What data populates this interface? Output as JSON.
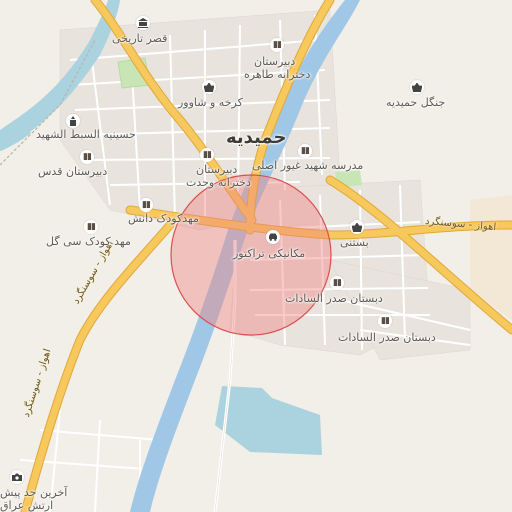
{
  "map": {
    "city_label": "حمیدیه",
    "road_labels": {
      "east_highway": "اهواز - سوسنگرد",
      "south_west_highway": "اهواز - سوسنگرد",
      "south_west_highway_2": "اهواز - سوسنگرد"
    },
    "places": {
      "historic_palace": "قصر تاریخی",
      "girls_high_school_tahereh_line1": "دبیرستان",
      "girls_high_school_tahereh_line2": "دخترانه طاهره",
      "karkheh_shavour": "کرخه و شاوور",
      "hamidiyeh_forest": "جنگل حمیدیه",
      "hosseiniyeh": "حسینیه السبط الشهید",
      "school_ghayour": "مدرسه شهید غیور اصلی",
      "high_school_qods": "دبیرستان قدس",
      "girls_high_school_vahdat_line1": "دبیرستان",
      "girls_high_school_vahdat_line2": "دخترانه وحدت",
      "kindergarten_danesh": "مهدکودک دانش",
      "kindergarten_sibgol": "مهد کودک سی گل",
      "tractor_mechanic": "مکانیکی تراکتور",
      "bastani": "بستنی",
      "primary_sadr_1": "دبستان صدر السادات",
      "primary_sadr_2": "دبستان صدر السادات",
      "last_border_line1": "آخرین حد پیش",
      "last_border_line2": "ارتش عراق"
    },
    "icons": {
      "palace": "museum-icon",
      "school": "school-icon",
      "shop": "shopping-basket-icon",
      "religious": "mosque-icon",
      "car": "car-repair-icon",
      "camera": "camera-icon"
    },
    "colors": {
      "land": "#f2efe9",
      "water": "#aad3df",
      "river": "#a0c8e6",
      "highway": "#f7c85c",
      "highway_casing": "#e0a73a",
      "minor_road": "#ffffff",
      "park": "#c8e6b5",
      "highlight_fill": "#f08080",
      "highlight_stroke": "#d94f4f"
    }
  }
}
